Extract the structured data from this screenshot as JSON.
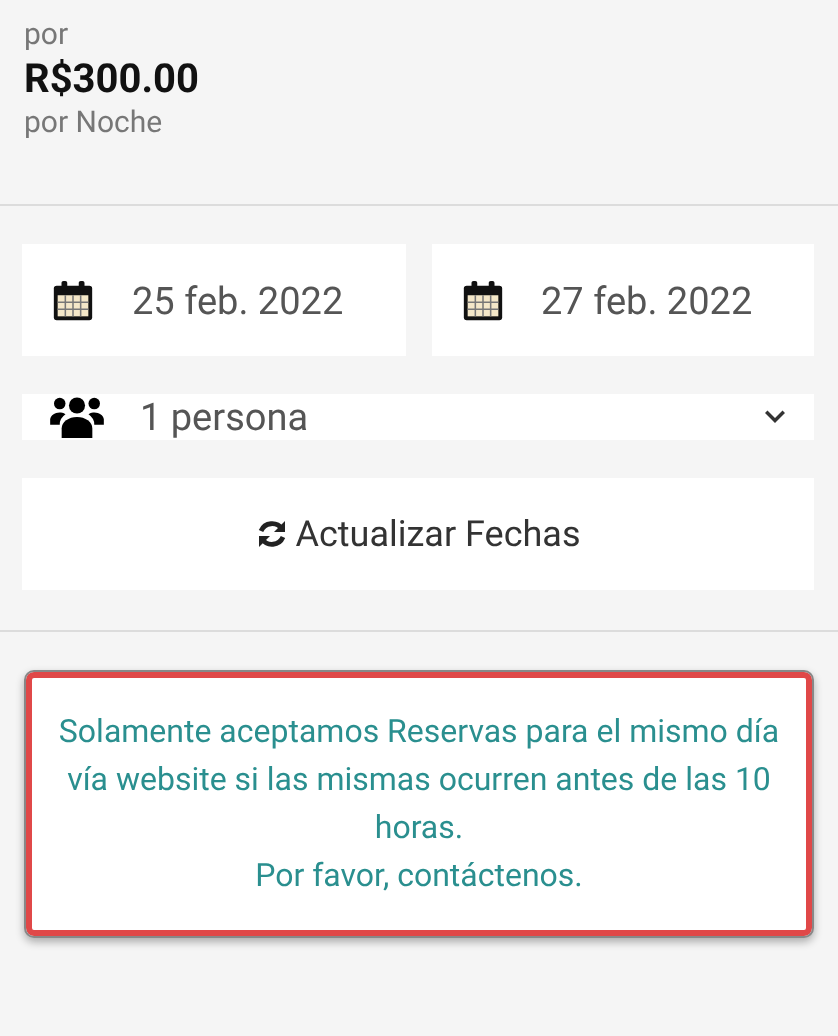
{
  "price": {
    "prefix": "por",
    "amount": "R$300.00",
    "unit": "por Noche"
  },
  "dates": [
    {
      "value": "25 feb. 2022"
    },
    {
      "value": "27 feb. 2022"
    }
  ],
  "guests": {
    "value": "1 persona"
  },
  "update_button": {
    "label": "Actualizar Fechas"
  },
  "notice": {
    "message": "Solamente aceptamos Reservas para el mismo día vía website si las mismas ocurren antes de las 10 horas.",
    "contact": "Por favor, contáctenos."
  }
}
